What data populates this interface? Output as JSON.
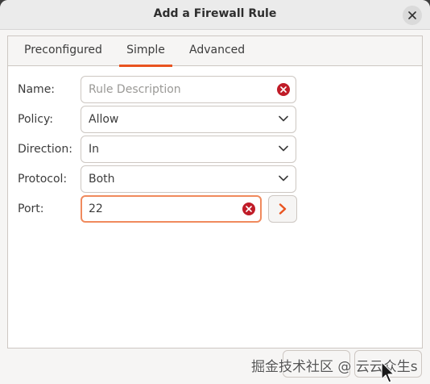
{
  "window": {
    "title": "Add a Firewall Rule"
  },
  "tabs": [
    {
      "label": "Preconfigured"
    },
    {
      "label": "Simple"
    },
    {
      "label": "Advanced"
    }
  ],
  "form": {
    "name": {
      "label": "Name:",
      "placeholder": "Rule Description",
      "value": ""
    },
    "policy": {
      "label": "Policy:",
      "value": "Allow"
    },
    "direction": {
      "label": "Direction:",
      "value": "In"
    },
    "protocol": {
      "label": "Protocol:",
      "value": "Both"
    },
    "port": {
      "label": "Port:",
      "value": "22"
    }
  },
  "watermark": "掘金技术社区 @ 云云众生s",
  "colors": {
    "accent": "#e95420",
    "clear": "#c01c28",
    "focus": "#f08a5d"
  }
}
